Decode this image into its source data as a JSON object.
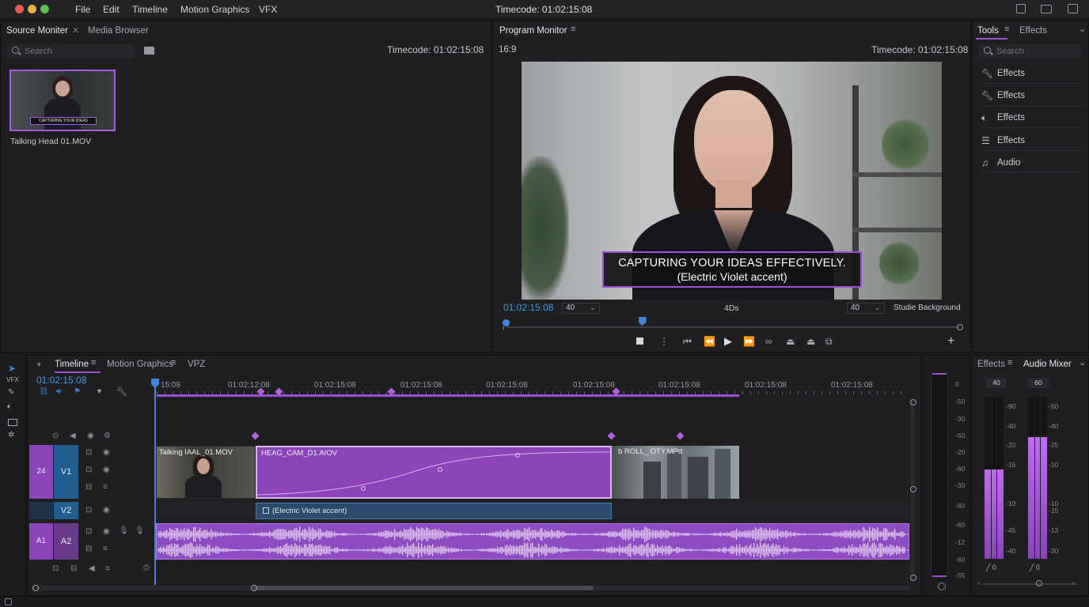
{
  "menubar": {
    "items": [
      "File",
      "Edit",
      "Timeline",
      "Motion Graphics",
      "VFX"
    ],
    "timecode": "Timecode: 01:02:15:08"
  },
  "source": {
    "tabs": [
      "Source Moniter",
      "Media Browser"
    ],
    "search_placeholder": "Search",
    "timecode": "Timecode: 01:02:15:08",
    "clip_name": "Talking Head 01.MOV",
    "thumb_caption": "CAPTURING YOUR IDEAS EFFECTIVELY."
  },
  "program": {
    "title": "Program Monitor",
    "aspect": "16:9",
    "timecode": "Timecode: 01:02:15:08",
    "caption_line1": "CAPTURING YOUR IDEAS EFFECTIVELY.",
    "caption_line2": "(Electric Violet accent)",
    "current_tc": "01:02:15:08",
    "sel1": "40",
    "mid_label": "4Ds",
    "sel2": "40",
    "background_label": "Studie Background",
    "scrub_progress": 0.3
  },
  "tools": {
    "tabs": [
      "Tools",
      "Effects"
    ],
    "search_placeholder": "Search",
    "items": [
      {
        "icon": "wrench-icon",
        "label": "Effects"
      },
      {
        "icon": "wrench-icon",
        "label": "Effects"
      },
      {
        "icon": "speaker-icon",
        "label": "Effects"
      },
      {
        "icon": "sliders-icon",
        "label": "Effects"
      },
      {
        "icon": "audio-icon",
        "label": "Audio"
      }
    ]
  },
  "toolstrip": {
    "vfx_label": "VFX"
  },
  "timeline": {
    "tabs": [
      "Timeline",
      "Motion Graphics",
      "VPZ"
    ],
    "timecode": "01:02:15:08",
    "ruler": [
      "15:08",
      "01:02:12:08",
      "01:02:15:08",
      "01:02:15:08",
      "01:02:15:08",
      "01:02:15:08",
      "01:02:15:08",
      "01:02:15:08",
      "01:02:15:08"
    ],
    "tracks": {
      "v_left": "24",
      "v1": "V1",
      "v2": "V2",
      "a_left": "A1",
      "a2": "A2"
    },
    "clips": {
      "c1": "Talking IAAL_01.MOV",
      "c2": "HEAG_CAM_D1.AIOV",
      "c3": "b ROLL_ OTY.MPd",
      "title_clip": "(Electric Violet accent)"
    }
  },
  "meter": {
    "labels": [
      "0",
      "-50",
      "-30",
      "-50",
      "-20",
      "-60",
      "-30",
      "-60",
      "-60",
      "-12",
      "-60",
      "-55"
    ]
  },
  "mixer": {
    "tabs": [
      "Effects",
      "Audio Mixer"
    ],
    "ch1_value": "40",
    "ch2_value": "60",
    "ch1_scale": [
      "-90",
      "-40",
      "-20",
      "-15",
      "-10",
      "-45",
      "-40"
    ],
    "ch2_scale": [
      "-50",
      "-40",
      "-25",
      "-10",
      "-10",
      "-15",
      "-13",
      "-30"
    ],
    "ch1_foot": "0",
    "ch2_foot": "0",
    "ch1_level": 0.55,
    "ch2_level": 0.75
  },
  "colors": {
    "accent": "#9b4fd6",
    "clip": "#8a44b8",
    "title_clip": "#2a4a6e",
    "playhead": "#3c86e0",
    "timecode": "#3c9be8"
  }
}
